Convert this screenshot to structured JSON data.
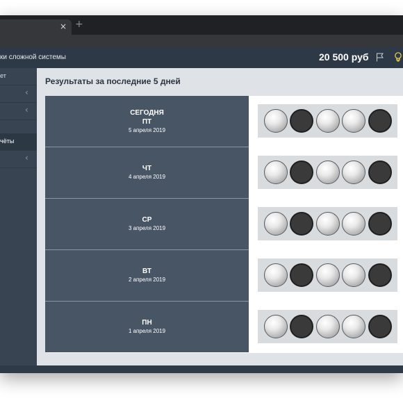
{
  "browser": {
    "tab_close_glyph": "×",
    "new_tab_glyph": "+"
  },
  "header": {
    "app_title": "ки сложной системы",
    "balance": "20 500 руб",
    "icons": [
      "flag-icon",
      "lightbulb-icon"
    ]
  },
  "sidebar": {
    "items": [
      {
        "label": "ет",
        "chevron": ""
      },
      {
        "label": "",
        "chevron": "‹"
      },
      {
        "label": "",
        "chevron": "‹"
      },
      {
        "label": "чёты",
        "chevron": "",
        "active": true
      },
      {
        "label": "",
        "chevron": "‹"
      }
    ]
  },
  "main": {
    "title": "Результаты за последние 5 дней",
    "days": [
      {
        "today": "СЕГОДНЯ",
        "name": "ПТ",
        "date": "5 апреля 2019",
        "balls": [
          "white",
          "black",
          "white",
          "white",
          "black"
        ]
      },
      {
        "today": "",
        "name": "ЧТ",
        "date": "4 апреля 2019",
        "balls": [
          "white",
          "black",
          "white",
          "white",
          "black"
        ]
      },
      {
        "today": "",
        "name": "СР",
        "date": "3 апреля 2019",
        "balls": [
          "white",
          "black",
          "white",
          "white",
          "black"
        ]
      },
      {
        "today": "",
        "name": "ВТ",
        "date": "2 апреля 2019",
        "balls": [
          "white",
          "black",
          "white",
          "white",
          "black"
        ]
      },
      {
        "today": "",
        "name": "ПН",
        "date": "1 апреля 2019",
        "balls": [
          "white",
          "black",
          "white",
          "white",
          "black"
        ]
      }
    ]
  },
  "colors": {
    "header_bg": "#2e3947",
    "sidebar_bg": "#384452",
    "day_cell_bg": "#485565",
    "content_bg": "#dfe3e7"
  }
}
